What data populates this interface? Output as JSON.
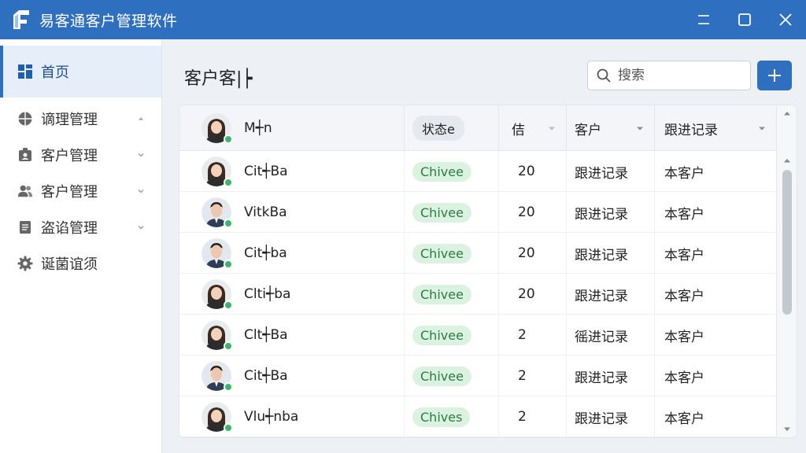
{
  "window": {
    "title": "易客通客户管理软件"
  },
  "sidebar": {
    "items": [
      {
        "label": "首页",
        "icon": "dashboard-icon"
      },
      {
        "label": "谪理管理",
        "icon": "globe-icon"
      },
      {
        "label": "客户管理",
        "icon": "contact-icon"
      },
      {
        "label": "客户管理",
        "icon": "users-icon"
      },
      {
        "label": "盗谄管理",
        "icon": "document-icon"
      },
      {
        "label": "诞菌谊须",
        "icon": "gear-icon"
      }
    ]
  },
  "main": {
    "page_title": "客户客|┝",
    "search_placeholder": "搜索"
  },
  "table": {
    "headers": {
      "name": "M┽n",
      "status": "状态e",
      "num": "佶",
      "customer": "客户",
      "follow": "跟进记录"
    },
    "rows": [
      {
        "name": "Cit┽Ba",
        "status": "Chivee",
        "num": "20",
        "customer": "跟进记录",
        "follow": "本客户",
        "avatar": "female"
      },
      {
        "name": "VitkBa",
        "status": "Chivee",
        "num": "20",
        "customer": "跟进记录",
        "follow": "本客户",
        "avatar": "male"
      },
      {
        "name": "Cit┽ba",
        "status": "Chivee",
        "num": "20",
        "customer": "跟进记录",
        "follow": "本客户",
        "avatar": "male"
      },
      {
        "name": "Clti┽ba",
        "status": "Chivee",
        "num": "20",
        "customer": "跟进记录",
        "follow": "本客户",
        "avatar": "female"
      },
      {
        "name": "Clt┽Ba",
        "status": "Chivee",
        "num": "2",
        "customer": "徭进记录",
        "follow": "本客户",
        "avatar": "female"
      },
      {
        "name": "Cit┽Ba",
        "status": "Chivee",
        "num": "2",
        "customer": "跟进记录",
        "follow": "本客户",
        "avatar": "male"
      },
      {
        "name": "Vlu┽nba",
        "status": "Chives",
        "num": "2",
        "customer": "跟进记录",
        "follow": "本客户",
        "avatar": "female"
      }
    ]
  },
  "colors": {
    "titlebar": "#2f6fbf",
    "accent": "#2f6fbf",
    "status_bg": "#dbf2e1",
    "online": "#3cb46a"
  }
}
